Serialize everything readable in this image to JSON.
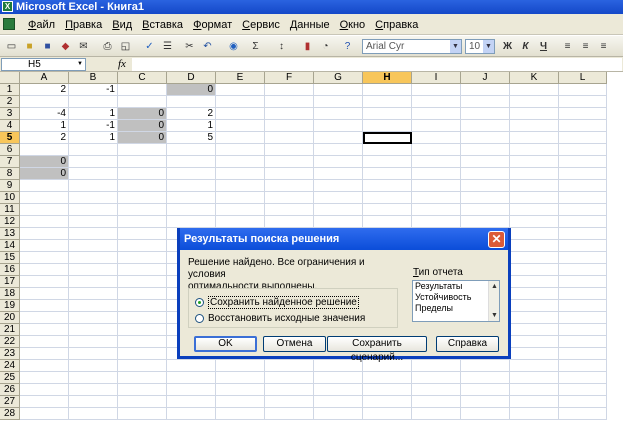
{
  "window": {
    "title": "Microsoft Excel - Книга1"
  },
  "menu": [
    "Файл",
    "Правка",
    "Вид",
    "Вставка",
    "Формат",
    "Сервис",
    "Данные",
    "Окно",
    "Справка"
  ],
  "toolbar": {
    "font_name": "Arial Cyr",
    "font_size": "10",
    "bold": "Ж",
    "italic": "К",
    "underline": "Ч"
  },
  "formula_bar": {
    "name_box": "H5",
    "fx_label": "fx",
    "formula": ""
  },
  "columns": [
    "A",
    "B",
    "C",
    "D",
    "E",
    "F",
    "G",
    "H",
    "I",
    "J",
    "K",
    "L"
  ],
  "active_column": "H",
  "active_row": 5,
  "rows": [
    1,
    2,
    3,
    4,
    5,
    6,
    7,
    8,
    9,
    10,
    11,
    12,
    13,
    14,
    15,
    16,
    17,
    18,
    19,
    20,
    21,
    22,
    23,
    24,
    25,
    26,
    27,
    28
  ],
  "cells": {
    "A1": "2",
    "B1": "-1",
    "D1": "0",
    "A3": "-4",
    "B3": "1",
    "C3": "0",
    "D3": "2",
    "A4": "1",
    "B4": "-1",
    "C4": "0",
    "D4": "1",
    "A5": "2",
    "B5": "1",
    "C5": "0",
    "D5": "5",
    "A7": "0",
    "A8": "0"
  },
  "shaded_cells": [
    "D1",
    "C3",
    "C4",
    "C5",
    "A7",
    "A8"
  ],
  "selected_cell": "H5",
  "dialog": {
    "title": "Результаты поиска решения",
    "message_line1": "Решение найдено. Все ограничения и условия",
    "message_line2": "оптимальности выполнены.",
    "report_type_label": "Тип отчета",
    "reports": [
      "Результаты",
      "Устойчивость",
      "Пределы"
    ],
    "options": [
      {
        "label": "Сохранить найденное решение",
        "selected": true
      },
      {
        "label": "Восстановить исходные значения",
        "selected": false
      }
    ],
    "buttons": {
      "ok": "OK",
      "cancel": "Отмена",
      "save_scenario": "Сохранить сценарий...",
      "help": "Справка"
    }
  }
}
